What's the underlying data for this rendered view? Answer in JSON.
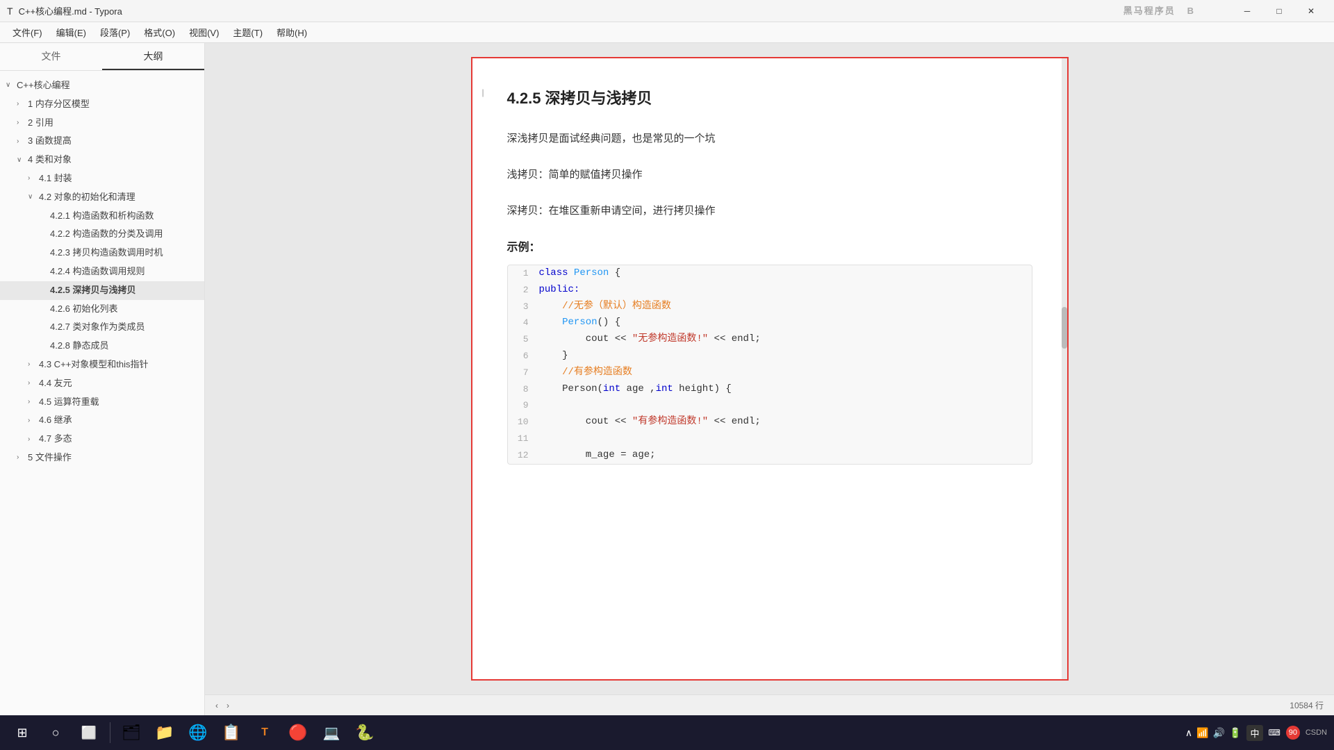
{
  "titleBar": {
    "title": "C++核心编程.md - Typora",
    "minBtn": "─",
    "maxBtn": "□",
    "closeBtn": "✕"
  },
  "menuBar": {
    "items": [
      "文件(F)",
      "编辑(E)",
      "段落(P)",
      "格式(O)",
      "视图(V)",
      "主题(T)",
      "帮助(H)"
    ]
  },
  "watermark": "黑马程序员",
  "sidebar": {
    "tab1": "文件",
    "tab2": "大纲",
    "treeItems": [
      {
        "label": "C++核心编程",
        "level": 0,
        "arrow": "∨",
        "id": "root"
      },
      {
        "label": "1 内存分区模型",
        "level": 1,
        "arrow": "›",
        "id": "s1"
      },
      {
        "label": "2 引用",
        "level": 1,
        "arrow": "›",
        "id": "s2"
      },
      {
        "label": "3 函数提高",
        "level": 1,
        "arrow": "›",
        "id": "s3"
      },
      {
        "label": "4 类和对象",
        "level": 1,
        "arrow": "∨",
        "id": "s4"
      },
      {
        "label": "4.1 封装",
        "level": 2,
        "arrow": "›",
        "id": "s41"
      },
      {
        "label": "4.2 对象的初始化和清理",
        "level": 2,
        "arrow": "∨",
        "id": "s42"
      },
      {
        "label": "4.2.1 构造函数和析构函数",
        "level": 3,
        "arrow": "",
        "id": "s421"
      },
      {
        "label": "4.2.2 构造函数的分类及调用",
        "level": 3,
        "arrow": "",
        "id": "s422"
      },
      {
        "label": "4.2.3 拷贝构造函数调用时机",
        "level": 3,
        "arrow": "",
        "id": "s423"
      },
      {
        "label": "4.2.4 构造函数调用规则",
        "level": 3,
        "arrow": "",
        "id": "s424"
      },
      {
        "label": "4.2.5 深拷贝与浅拷贝",
        "level": 3,
        "arrow": "",
        "id": "s425",
        "active": true
      },
      {
        "label": "4.2.6 初始化列表",
        "level": 3,
        "arrow": "",
        "id": "s426"
      },
      {
        "label": "4.2.7 类对象作为类成员",
        "level": 3,
        "arrow": "",
        "id": "s427"
      },
      {
        "label": "4.2.8 静态成员",
        "level": 3,
        "arrow": "",
        "id": "s428"
      },
      {
        "label": "4.3 C++对象模型和this指针",
        "level": 2,
        "arrow": "›",
        "id": "s43"
      },
      {
        "label": "4.4 友元",
        "level": 2,
        "arrow": "›",
        "id": "s44"
      },
      {
        "label": "4.5 运算符重载",
        "level": 2,
        "arrow": "›",
        "id": "s45"
      },
      {
        "label": "4.6 继承",
        "level": 2,
        "arrow": "›",
        "id": "s46"
      },
      {
        "label": "4.7 多态",
        "level": 2,
        "arrow": "›",
        "id": "s47"
      },
      {
        "label": "5 文件操作",
        "level": 1,
        "arrow": "›",
        "id": "s5"
      }
    ]
  },
  "document": {
    "title": "4.2.5 深拷贝与浅拷贝",
    "para1": "深浅拷贝是面试经典问题，也是常见的一个坑",
    "label_shallow": "浅拷贝：简单的赋值拷贝操作",
    "label_deep": "深拷贝：在堆区重新申请空间，进行拷贝操作",
    "example_title": "示例：",
    "codeLines": [
      {
        "num": "1",
        "content": "class Person {",
        "tokens": [
          {
            "text": "class ",
            "cls": "kw-blue"
          },
          {
            "text": "Person",
            "cls": "kw-cyan"
          },
          {
            "text": " {",
            "cls": ""
          }
        ]
      },
      {
        "num": "2",
        "content": "public:",
        "tokens": [
          {
            "text": "public:",
            "cls": "kw-blue"
          }
        ]
      },
      {
        "num": "3",
        "content": "    //无参（默认）构造函数",
        "tokens": [
          {
            "text": "    //无参（默认）构造函数",
            "cls": "kw-comment"
          }
        ]
      },
      {
        "num": "4",
        "content": "    Person() {",
        "tokens": [
          {
            "text": "    Person",
            "cls": "kw-cyan"
          },
          {
            "text": "() {",
            "cls": ""
          }
        ]
      },
      {
        "num": "5",
        "content": "        cout << \"无参构造函数!\" << endl;",
        "tokens": [
          {
            "text": "        cout ",
            "cls": ""
          },
          {
            "text": "<<",
            "cls": ""
          },
          {
            "text": " \"无参构造函数!\"",
            "cls": "kw-string"
          },
          {
            "text": " << endl;",
            "cls": ""
          }
        ]
      },
      {
        "num": "6",
        "content": "    }",
        "tokens": [
          {
            "text": "    }",
            "cls": ""
          }
        ]
      },
      {
        "num": "7",
        "content": "    //有参构造函数",
        "tokens": [
          {
            "text": "    //有参构造函数",
            "cls": "kw-comment"
          }
        ]
      },
      {
        "num": "8",
        "content": "    Person(int age ,int height) {",
        "tokens": [
          {
            "text": "    Person(",
            "cls": ""
          },
          {
            "text": "int",
            "cls": "kw-blue"
          },
          {
            "text": " age ,",
            "cls": ""
          },
          {
            "text": "int",
            "cls": "kw-blue"
          },
          {
            "text": " height) {",
            "cls": ""
          }
        ]
      },
      {
        "num": "9",
        "content": "",
        "tokens": []
      },
      {
        "num": "10",
        "content": "        cout << \"有参构造函数!\" << endl;",
        "tokens": [
          {
            "text": "        cout ",
            "cls": ""
          },
          {
            "text": "<<",
            "cls": ""
          },
          {
            "text": " \"有参构造函数!\"",
            "cls": "kw-string"
          },
          {
            "text": " << endl;",
            "cls": ""
          }
        ]
      },
      {
        "num": "11",
        "content": "",
        "tokens": []
      },
      {
        "num": "12",
        "content": "        m_age = age;",
        "tokens": [
          {
            "text": "        m_age = age;",
            "cls": ""
          }
        ]
      }
    ]
  },
  "bottomBar": {
    "lineCount": "10584 行"
  },
  "taskbar": {
    "startIcon": "⊞",
    "searchIcon": "○",
    "taskviewIcon": "⬜",
    "apps": [
      "🗂",
      "📁",
      "🌐",
      "📋",
      "📝",
      "🔴",
      "💻",
      "⚙"
    ],
    "systemIcons": [
      "∧",
      "🔊",
      "📶",
      "中",
      "⌨"
    ],
    "time": "90",
    "inputMethod": "中",
    "batteryIcon": "🔋"
  }
}
